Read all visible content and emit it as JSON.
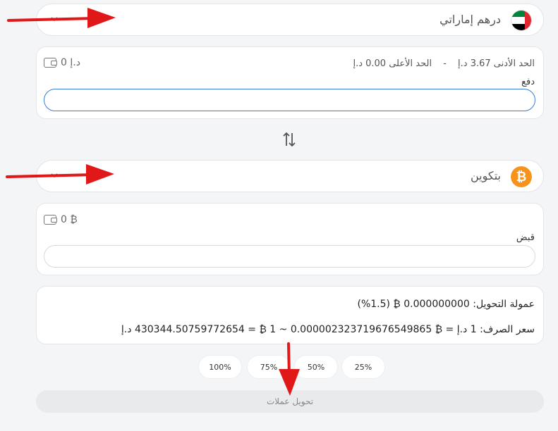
{
  "from_currency": {
    "name": "درهم إماراتي",
    "flag_icon": "uae-flag-icon"
  },
  "pay_card": {
    "min_label": "الحد الأدنى 3.67 د.إ",
    "separator": "-",
    "max_label": "الحد الأعلى 0.00 د.إ",
    "balance": "0 د.إ",
    "field_label": "دفع",
    "input_value": ""
  },
  "to_currency": {
    "name": "بتكوين",
    "icon_glyph": "₿",
    "flag_icon": "bitcoin-icon"
  },
  "receive_card": {
    "balance": "0 ₿",
    "field_label": "قبض",
    "input_value": ""
  },
  "info": {
    "commission": "عمولة التحويل: 0.000000000 ₿ (1.5%)",
    "rate": "سعر الصرف: 1 د.إ = ₿ 0.0000023237196765498​65 ~ 1 ₿ = 430344.50759772654 د.إ"
  },
  "percent_buttons": [
    "100%",
    "75%",
    "50%",
    "25%"
  ],
  "convert_button": "تحويل عملات",
  "colors": {
    "annotation_red": "#e01818",
    "input_focus": "#3c7ad6",
    "bitcoin": "#f7931a"
  }
}
